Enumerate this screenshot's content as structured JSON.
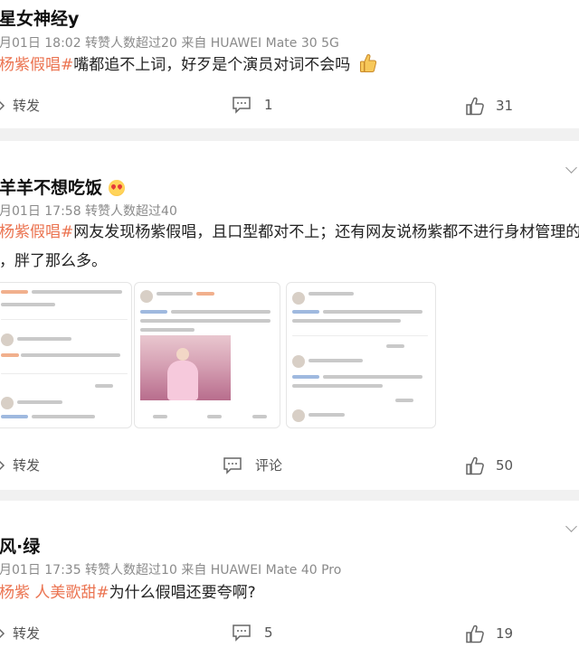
{
  "posts": [
    {
      "username": "星女神经y",
      "meta": "月01日 18:02 转赞人数超过20  来自 HUAWEI Mate 30 5G",
      "tag": "杨紫假唱#",
      "text": "嘴都追不上词，好歹是个演员对词不会吗",
      "forward_label": "转发",
      "comment_count": "1",
      "like_count": "31"
    },
    {
      "username": "羊羊不想吃饭",
      "meta": "月01日 17:58 转赞人数超过40",
      "tag": "杨紫假唱#",
      "text_line1": "网友发现杨紫假唱，且口型都对不上；还有网友说杨紫都不进行身材管理的",
      "text_line2": "，胖了那么多。",
      "forward_label": "转发",
      "comment_label": "评论",
      "like_count": "50"
    },
    {
      "username": "风·绿",
      "meta": "月01日 17:35 转赞人数超过10  来自 HUAWEI Mate 40 Pro",
      "tag": "杨紫 人美歌甜#",
      "text": "为什么假唱还要夸啊?",
      "forward_label": "转发",
      "comment_count": "5",
      "like_count": "19"
    }
  ],
  "colors": {
    "accent": "#eb7350",
    "meta": "#8a8a8a",
    "separator": "#f1f1f1"
  }
}
